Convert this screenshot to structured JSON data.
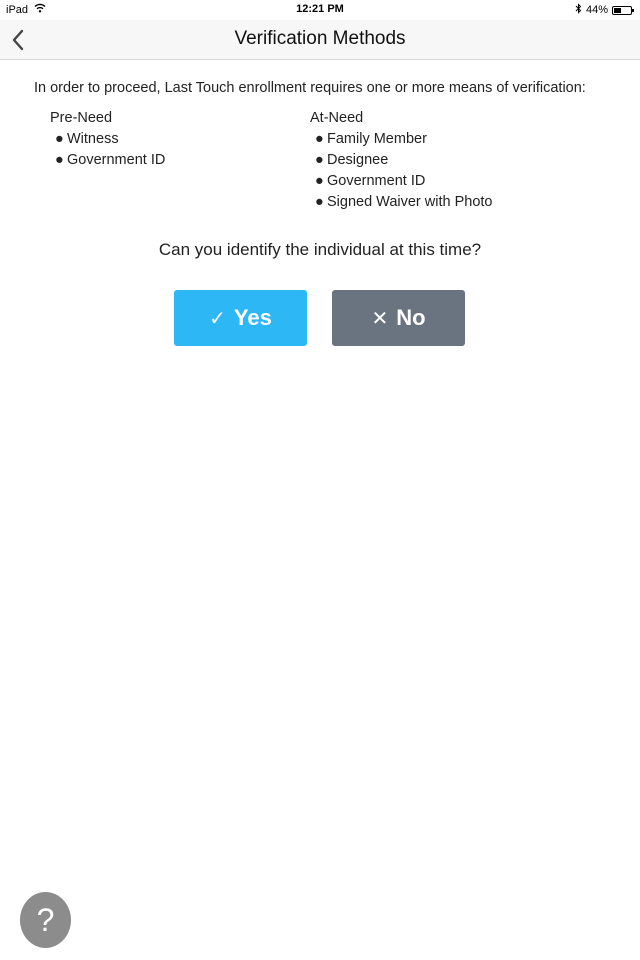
{
  "status_bar": {
    "device": "iPad",
    "time": "12:21 PM",
    "battery_percent": "44%",
    "battery_level": 0.44,
    "icons": [
      "wifi-icon",
      "bluetooth-icon",
      "battery-icon"
    ]
  },
  "nav": {
    "title": "Verification Methods",
    "back_icon": "chevron-left-icon"
  },
  "content": {
    "intro": "In order to proceed, Last Touch enrollment requires one or more means of verification:",
    "pre_need": {
      "heading": "Pre-Need",
      "items": [
        "Witness",
        "Government ID"
      ]
    },
    "at_need": {
      "heading": "At-Need",
      "items": [
        "Family Member",
        "Designee",
        "Government ID",
        "Signed Waiver with Photo"
      ]
    },
    "question": "Can you identify the individual at this time?",
    "yes_button": {
      "glyph": "✓",
      "label": "Yes",
      "color": "#2db8f5"
    },
    "no_button": {
      "glyph": "✕",
      "label": "No",
      "color": "#6a7380"
    }
  },
  "help_button": {
    "label": "?",
    "icon": "help-icon",
    "color": "#8c8c8c"
  }
}
